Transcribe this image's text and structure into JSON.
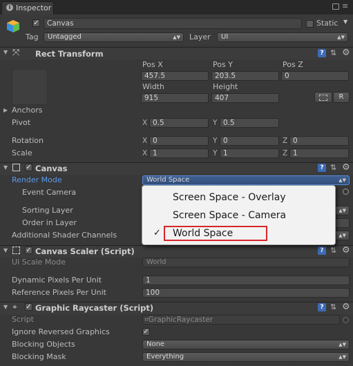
{
  "tab": {
    "title": "Inspector"
  },
  "header": {
    "name": "Canvas",
    "static_label": "Static",
    "tag_label": "Tag",
    "tag_value": "Untagged",
    "layer_label": "Layer",
    "layer_value": "UI"
  },
  "rect_transform": {
    "title": "Rect Transform",
    "pos_x_label": "Pos X",
    "pos_y_label": "Pos Y",
    "pos_z_label": "Pos Z",
    "pos_x": "457.5",
    "pos_y": "203.5",
    "pos_z": "0",
    "width_label": "Width",
    "height_label": "Height",
    "width": "915",
    "height": "407",
    "r_button": "R",
    "anchors_label": "Anchors",
    "pivot_label": "Pivot",
    "pivot_x": "0.5",
    "pivot_y": "0.5",
    "rotation_label": "Rotation",
    "rot_x": "0",
    "rot_y": "0",
    "rot_z": "0",
    "scale_label": "Scale",
    "scale_x": "1",
    "scale_y": "1",
    "scale_z": "1",
    "x_axis": "X",
    "y_axis": "Y",
    "z_axis": "Z"
  },
  "canvas": {
    "title": "Canvas",
    "render_mode_label": "Render Mode",
    "render_mode_value": "World Space",
    "event_camera_label": "Event Camera",
    "sorting_layer_label": "Sorting Layer",
    "order_in_layer_label": "Order in Layer",
    "shader_channels_label": "Additional Shader Channels"
  },
  "render_mode_menu": {
    "options": [
      "Screen Space - Overlay",
      "Screen Space - Camera",
      "World Space"
    ],
    "selected_index": 2,
    "check": "✓",
    "highlight_color": "#d9252a"
  },
  "canvas_scaler": {
    "title": "Canvas Scaler (Script)",
    "ui_scale_mode_label": "UI Scale Mode",
    "ui_scale_mode_value": "World",
    "dynamic_pixels_label": "Dynamic Pixels Per Unit",
    "dynamic_pixels_value": "1",
    "reference_pixels_label": "Reference Pixels Per Unit",
    "reference_pixels_value": "100"
  },
  "graphic_raycaster": {
    "title": "Graphic Raycaster (Script)",
    "script_label": "Script",
    "script_value": "GraphicRaycaster",
    "ignore_reversed_label": "Ignore Reversed Graphics",
    "blocking_objects_label": "Blocking Objects",
    "blocking_objects_value": "None",
    "blocking_mask_label": "Blocking Mask",
    "blocking_mask_value": "Everything"
  }
}
